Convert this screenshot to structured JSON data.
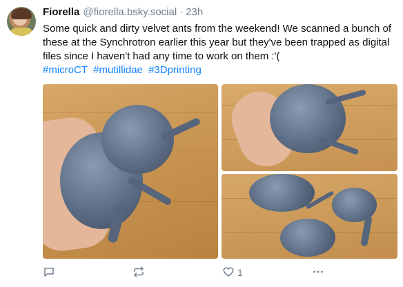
{
  "author": {
    "display_name": "Fiorella",
    "handle": "@fiorella.bsky.social",
    "separator": "·",
    "time": "23h"
  },
  "post": {
    "text": "Some quick and dirty velvet ants from the weekend! We scanned a bunch of these at the Synchrotron earlier this year but they've been trapped as digital files since I haven't had any time to work on them :'(",
    "hashtags": [
      "#microCT",
      "#mutillidae",
      "#3Dprinting"
    ]
  },
  "actions": {
    "reply_icon": "reply-icon",
    "repost_icon": "repost-icon",
    "like_icon": "heart-icon",
    "like_count": "1",
    "more_icon": "more-icon"
  },
  "colors": {
    "link": "#1083fe",
    "muted": "#6f7e8c",
    "text": "#0b0f14"
  }
}
